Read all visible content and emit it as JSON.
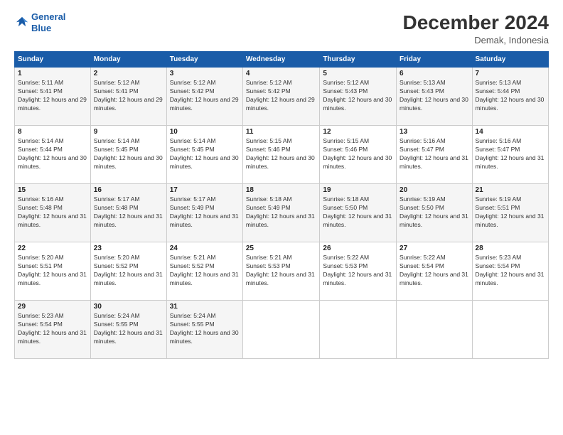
{
  "header": {
    "logo_line1": "General",
    "logo_line2": "Blue",
    "title": "December 2024",
    "subtitle": "Demak, Indonesia"
  },
  "calendar": {
    "days_of_week": [
      "Sunday",
      "Monday",
      "Tuesday",
      "Wednesday",
      "Thursday",
      "Friday",
      "Saturday"
    ],
    "weeks": [
      [
        null,
        {
          "day": 1,
          "sunrise": "5:11 AM",
          "sunset": "5:41 PM",
          "daylight": "12 hours and 29 minutes."
        },
        {
          "day": 2,
          "sunrise": "5:12 AM",
          "sunset": "5:41 PM",
          "daylight": "12 hours and 29 minutes."
        },
        {
          "day": 3,
          "sunrise": "5:12 AM",
          "sunset": "5:42 PM",
          "daylight": "12 hours and 29 minutes."
        },
        {
          "day": 4,
          "sunrise": "5:12 AM",
          "sunset": "5:42 PM",
          "daylight": "12 hours and 29 minutes."
        },
        {
          "day": 5,
          "sunrise": "5:12 AM",
          "sunset": "5:43 PM",
          "daylight": "12 hours and 30 minutes."
        },
        {
          "day": 6,
          "sunrise": "5:13 AM",
          "sunset": "5:43 PM",
          "daylight": "12 hours and 30 minutes."
        },
        {
          "day": 7,
          "sunrise": "5:13 AM",
          "sunset": "5:44 PM",
          "daylight": "12 hours and 30 minutes."
        }
      ],
      [
        {
          "day": 8,
          "sunrise": "5:14 AM",
          "sunset": "5:44 PM",
          "daylight": "12 hours and 30 minutes."
        },
        {
          "day": 9,
          "sunrise": "5:14 AM",
          "sunset": "5:45 PM",
          "daylight": "12 hours and 30 minutes."
        },
        {
          "day": 10,
          "sunrise": "5:14 AM",
          "sunset": "5:45 PM",
          "daylight": "12 hours and 30 minutes."
        },
        {
          "day": 11,
          "sunrise": "5:15 AM",
          "sunset": "5:46 PM",
          "daylight": "12 hours and 30 minutes."
        },
        {
          "day": 12,
          "sunrise": "5:15 AM",
          "sunset": "5:46 PM",
          "daylight": "12 hours and 30 minutes."
        },
        {
          "day": 13,
          "sunrise": "5:16 AM",
          "sunset": "5:47 PM",
          "daylight": "12 hours and 31 minutes."
        },
        {
          "day": 14,
          "sunrise": "5:16 AM",
          "sunset": "5:47 PM",
          "daylight": "12 hours and 31 minutes."
        }
      ],
      [
        {
          "day": 15,
          "sunrise": "5:16 AM",
          "sunset": "5:48 PM",
          "daylight": "12 hours and 31 minutes."
        },
        {
          "day": 16,
          "sunrise": "5:17 AM",
          "sunset": "5:48 PM",
          "daylight": "12 hours and 31 minutes."
        },
        {
          "day": 17,
          "sunrise": "5:17 AM",
          "sunset": "5:49 PM",
          "daylight": "12 hours and 31 minutes."
        },
        {
          "day": 18,
          "sunrise": "5:18 AM",
          "sunset": "5:49 PM",
          "daylight": "12 hours and 31 minutes."
        },
        {
          "day": 19,
          "sunrise": "5:18 AM",
          "sunset": "5:50 PM",
          "daylight": "12 hours and 31 minutes."
        },
        {
          "day": 20,
          "sunrise": "5:19 AM",
          "sunset": "5:50 PM",
          "daylight": "12 hours and 31 minutes."
        },
        {
          "day": 21,
          "sunrise": "5:19 AM",
          "sunset": "5:51 PM",
          "daylight": "12 hours and 31 minutes."
        }
      ],
      [
        {
          "day": 22,
          "sunrise": "5:20 AM",
          "sunset": "5:51 PM",
          "daylight": "12 hours and 31 minutes."
        },
        {
          "day": 23,
          "sunrise": "5:20 AM",
          "sunset": "5:52 PM",
          "daylight": "12 hours and 31 minutes."
        },
        {
          "day": 24,
          "sunrise": "5:21 AM",
          "sunset": "5:52 PM",
          "daylight": "12 hours and 31 minutes."
        },
        {
          "day": 25,
          "sunrise": "5:21 AM",
          "sunset": "5:53 PM",
          "daylight": "12 hours and 31 minutes."
        },
        {
          "day": 26,
          "sunrise": "5:22 AM",
          "sunset": "5:53 PM",
          "daylight": "12 hours and 31 minutes."
        },
        {
          "day": 27,
          "sunrise": "5:22 AM",
          "sunset": "5:54 PM",
          "daylight": "12 hours and 31 minutes."
        },
        {
          "day": 28,
          "sunrise": "5:23 AM",
          "sunset": "5:54 PM",
          "daylight": "12 hours and 31 minutes."
        }
      ],
      [
        {
          "day": 29,
          "sunrise": "5:23 AM",
          "sunset": "5:54 PM",
          "daylight": "12 hours and 31 minutes."
        },
        {
          "day": 30,
          "sunrise": "5:24 AM",
          "sunset": "5:55 PM",
          "daylight": "12 hours and 31 minutes."
        },
        {
          "day": 31,
          "sunrise": "5:24 AM",
          "sunset": "5:55 PM",
          "daylight": "12 hours and 30 minutes."
        },
        null,
        null,
        null,
        null
      ]
    ]
  }
}
